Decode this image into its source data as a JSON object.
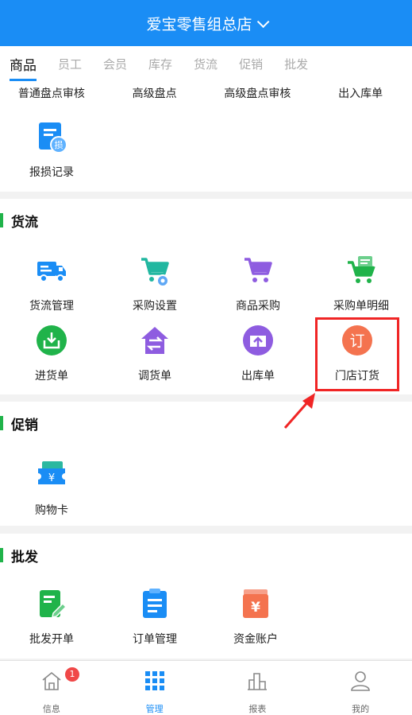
{
  "header": {
    "title": "爱宝零售组总店"
  },
  "tabs": [
    "商品",
    "员工",
    "会员",
    "库存",
    "货流",
    "促销",
    "批发"
  ],
  "stock_section": {
    "text_row": [
      "普通盘点审核",
      "高级盘点",
      "高级盘点审核",
      "出入库单"
    ],
    "damage_label": "报损记录",
    "damage_glyph": "损"
  },
  "goods_flow": {
    "title": "货流",
    "items": [
      "货流管理",
      "采购设置",
      "商品采购",
      "采购单明细",
      "进货单",
      "调货单",
      "出库单",
      "门店订货"
    ],
    "order_glyph": "订"
  },
  "promotion": {
    "title": "促销",
    "items": [
      "购物卡"
    ],
    "card_glyph": "¥"
  },
  "wholesale": {
    "title": "批发",
    "items": [
      "批发开单",
      "订单管理",
      "资金账户"
    ],
    "fund_glyph": "¥"
  },
  "bottom_nav": {
    "items": [
      "信息",
      "管理",
      "报表",
      "我的"
    ],
    "badge": "1"
  },
  "colors": {
    "brand": "#1a8df5",
    "section_bar": "#20b34a",
    "highlight": "#f02525"
  }
}
